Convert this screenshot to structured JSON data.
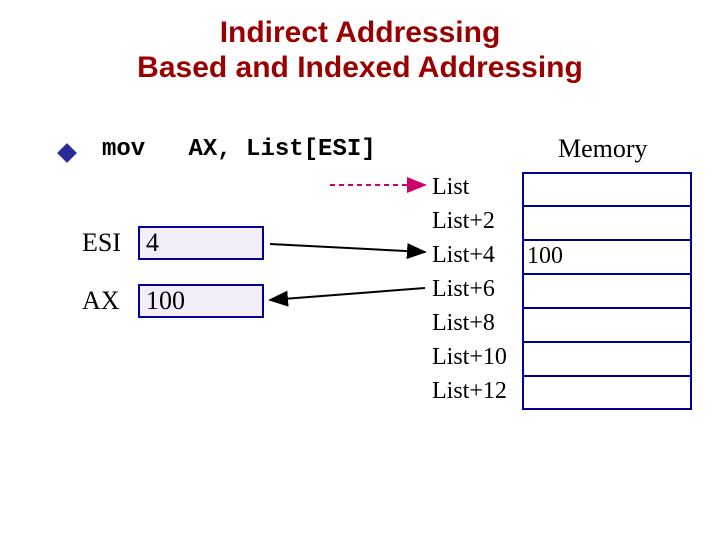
{
  "title_line1": "Indirect Addressing",
  "title_line2": "Based and Indexed Addressing",
  "instruction": {
    "mnemonic": "mov",
    "operands": "AX, List[ESI]"
  },
  "registers": {
    "esi": {
      "label": "ESI",
      "value": "4"
    },
    "ax": {
      "label": "AX",
      "value": "100"
    }
  },
  "memory": {
    "heading": "Memory",
    "addresses": [
      "List",
      "List+2",
      "List+4",
      "List+6",
      "List+8",
      "List+10",
      "List+12"
    ],
    "highlight_value": "100"
  }
}
